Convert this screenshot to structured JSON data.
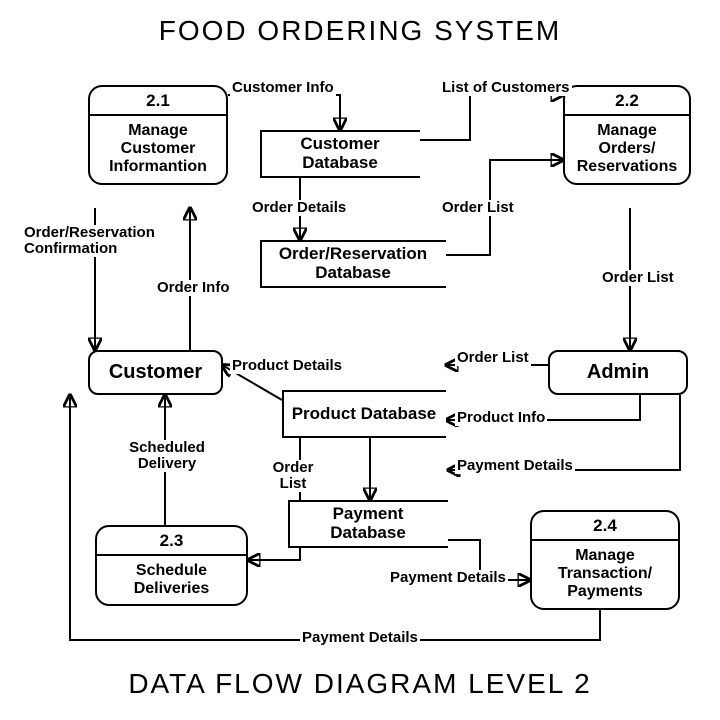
{
  "titleTop": "FOOD ORDERING SYSTEM",
  "titleBottom": "DATA FLOW DIAGRAM LEVEL 2",
  "processes": {
    "p21": {
      "num": "2.1",
      "desc": "Manage Customer Informantion"
    },
    "p22": {
      "num": "2.2",
      "desc": "Manage Orders/ Reservations"
    },
    "p23": {
      "num": "2.3",
      "desc": "Schedule Deliveries"
    },
    "p24": {
      "num": "2.4",
      "desc": "Manage Transaction/ Payments"
    }
  },
  "entities": {
    "customer": "Customer",
    "admin": "Admin"
  },
  "datastores": {
    "custDb": "Customer Database",
    "orderDb": "Order/Reservation Database",
    "productDb": "Product Database",
    "paymentDb": "Payment Database"
  },
  "flows": {
    "customerInfo": "Customer Info",
    "listCustomers": "List of Customers",
    "orderDetails": "Order Details",
    "orderList1": "Order List",
    "orderList2": "Order List",
    "orderList3": "Order List",
    "orderList4": "Order List",
    "orderInfo": "Order Info",
    "confirmation": "Order/Reservation Confirmation",
    "productDetails": "Product Details",
    "productInfo": "Product Info",
    "scheduledDelivery": "Scheduled Delivery",
    "paymentDetails1": "Payment Details",
    "paymentDetails2": "Payment Details",
    "paymentDetails3": "Payment Details"
  }
}
